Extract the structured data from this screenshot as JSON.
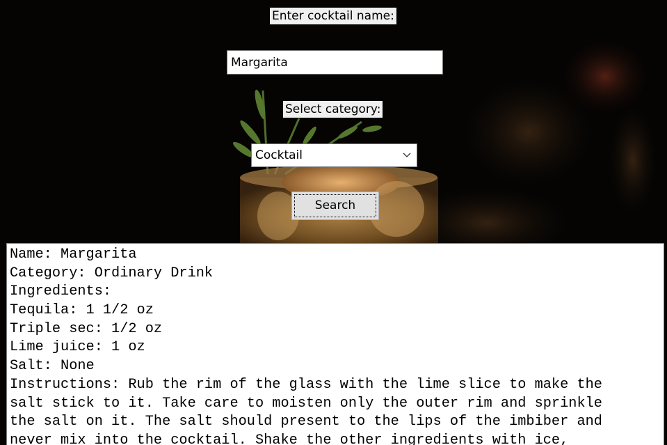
{
  "form": {
    "name_label": "Enter cocktail name:",
    "name_value": "Margarita",
    "category_label": "Select category:",
    "category_selected": "Cocktail",
    "search_label": "Search"
  },
  "result": {
    "lines": [
      "Name: Margarita",
      "Category: Ordinary Drink",
      "Ingredients:",
      "Tequila: 1 1/2 oz",
      "Triple sec: 1/2 oz",
      "Lime juice: 1 oz",
      "Salt: None",
      "Instructions: Rub the rim of the glass with the lime slice to make the",
      "salt stick to it. Take care to moisten only the outer rim and sprinkle",
      "the salt on it. The salt should present to the lips of the imbiber and",
      "never mix into the cocktail. Shake the other ingredients with ice,"
    ]
  },
  "icons": {
    "combo_arrow": "chevron-down-icon"
  },
  "colors": {
    "background": "#050403",
    "label_bg": "#f0f0f0",
    "entry_bg": "#ffffff",
    "button_bg": "#e1e1e1"
  }
}
